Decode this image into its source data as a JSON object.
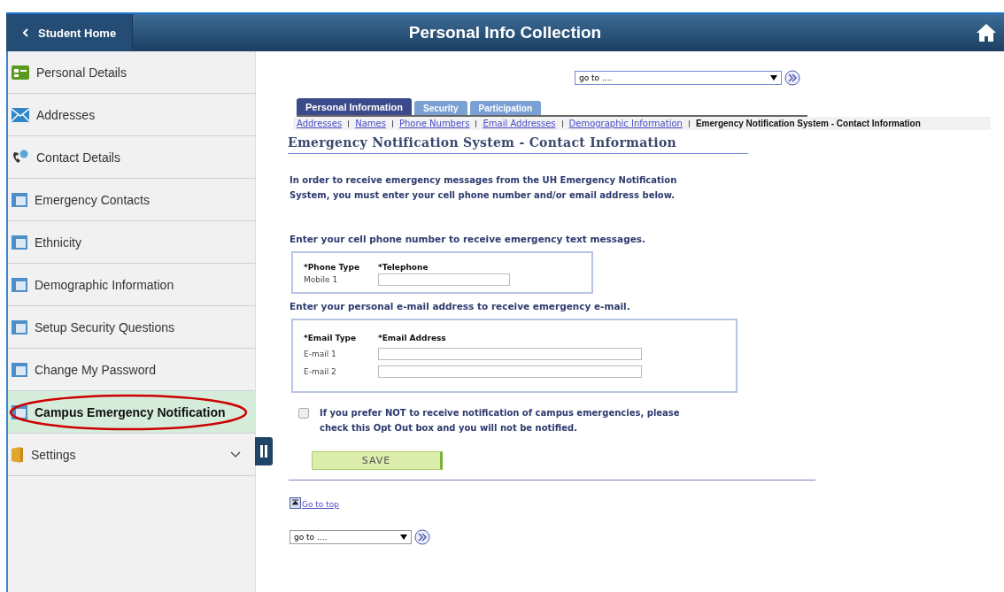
{
  "header": {
    "back": "Student Home",
    "title": "Personal Info Collection"
  },
  "sidebar": {
    "items": [
      {
        "label": "Personal Details",
        "kind": "card",
        "selected": false
      },
      {
        "label": "Addresses",
        "kind": "envelope",
        "selected": false
      },
      {
        "label": "Contact Details",
        "kind": "phone",
        "selected": false
      },
      {
        "label": "Emergency Contacts",
        "kind": "page",
        "selected": false
      },
      {
        "label": "Ethnicity",
        "kind": "page",
        "selected": false
      },
      {
        "label": "Demographic Information",
        "kind": "page",
        "selected": false
      },
      {
        "label": "Setup Security Questions",
        "kind": "page",
        "selected": false
      },
      {
        "label": "Change My Password",
        "kind": "page",
        "selected": false
      },
      {
        "label": "Campus Emergency Notification",
        "kind": "page",
        "selected": true
      },
      {
        "label": "Settings",
        "kind": "group",
        "selected": false
      }
    ]
  },
  "goto_top": {
    "value": "go to ...."
  },
  "tabs": [
    {
      "label": "Personal Information",
      "selected": true
    },
    {
      "label": "Security",
      "selected": false
    },
    {
      "label": "Participation",
      "selected": false
    }
  ],
  "breadcrumbs": [
    {
      "label": "Addresses",
      "kind": "link"
    },
    {
      "label": "Names",
      "kind": "link"
    },
    {
      "label": "Phone Numbers",
      "kind": "link"
    },
    {
      "label": "Email Addresses",
      "kind": "link"
    },
    {
      "label": "Demographic Information",
      "kind": "link"
    },
    {
      "label": "Emergency Notification System - Contact Information",
      "kind": "current"
    }
  ],
  "page_title": "Emergency Notification System - Contact Information",
  "intro": "In order to receive emergency messages from the UH Emergency Notification System, you must enter your cell phone number and/or email address below.",
  "phone_prompt": "Enter your cell phone number to receive emergency text messages.",
  "phone": {
    "columns": [
      "*Phone Type",
      "*Telephone"
    ],
    "rows": [
      {
        "type": "Mobile 1"
      }
    ]
  },
  "email_prompt": "Enter your personal e-mail address to receive emergency e-mail.",
  "email": {
    "columns": [
      "*Email Type",
      "*Email Address"
    ],
    "rows": [
      {
        "type": "E-mail 1"
      },
      {
        "type": "E-mail 2"
      }
    ]
  },
  "opt_out": {
    "label": "If you prefer NOT to receive notification of campus emergencies, please check this Opt Out box and you will not be notified.",
    "checked": false
  },
  "save": "SAVE",
  "go_to_top": "Go to top",
  "goto_bottom": {
    "value": "go to ...."
  }
}
